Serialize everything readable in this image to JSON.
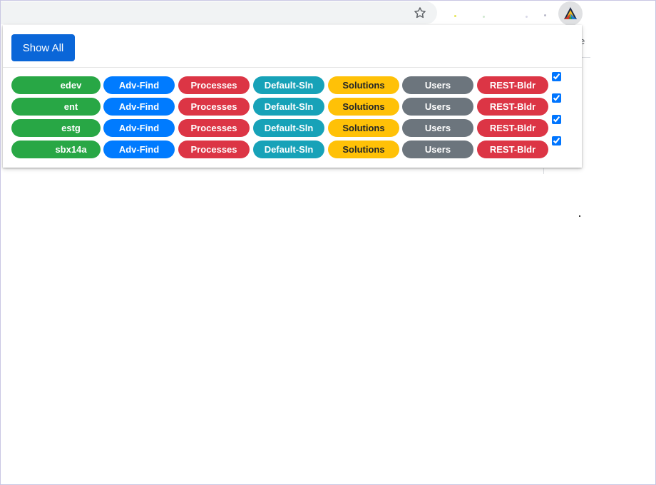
{
  "toolbar": {
    "star_icon": "star-outline-icon",
    "extension_icon": "extension-logo-icon"
  },
  "popup": {
    "show_all_label": "Show All",
    "button_labels": {
      "adv_find": "Adv-Find",
      "processes": "Processes",
      "default_sln": "Default-Sln",
      "solutions": "Solutions",
      "users": "Users",
      "rest_bldr": "REST-Bldr"
    },
    "rows": [
      {
        "env": "edev",
        "checked": true
      },
      {
        "env": "ent",
        "checked": true
      },
      {
        "env": "estg",
        "checked": true
      },
      {
        "env": "sbx14a",
        "checked": true
      }
    ]
  },
  "colors": {
    "show_all": "#0a66d8",
    "env": "#28a745",
    "adv_find": "#007bff",
    "processes": "#dc3545",
    "default_sln": "#17a2b8",
    "solutions": "#ffc107",
    "users": "#6c757d",
    "rest_bldr": "#dc3545"
  }
}
